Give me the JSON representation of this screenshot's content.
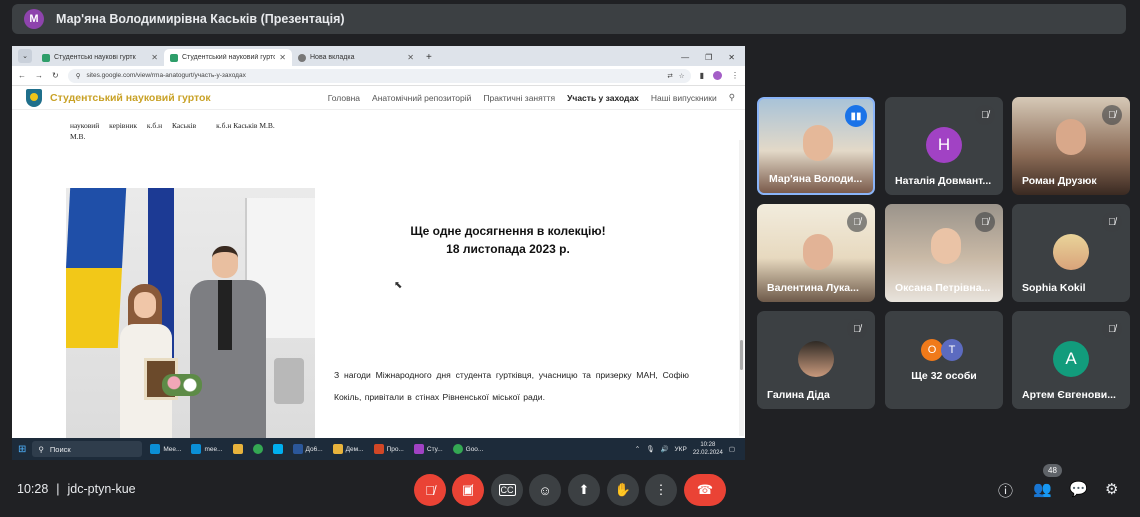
{
  "presenter": {
    "initial": "M",
    "title": "Мар'яна Володимирівна Каськів (Презентація)"
  },
  "browser": {
    "tabs": [
      {
        "label": "Студентські наукові гуртк",
        "active": false
      },
      {
        "label": "Студентський науковий гурто",
        "active": true
      },
      {
        "label": "Нова вкладка",
        "active": false
      }
    ],
    "url": "sites.google.com/view/rma-anatogurt/участь-у-заходах"
  },
  "site": {
    "name": "Студентський науковий гурток",
    "nav": [
      "Головна",
      "Анатомічний репозиторій",
      "Практичні заняття",
      "Участь у заходах",
      "Наші випускники"
    ],
    "active_nav": "Участь у заходах",
    "supervisor_line1": "науковий керівник к.б.н Каськів",
    "supervisor_line1b": "к.б.н Каськів М.В.",
    "supervisor_line2": "М.В.",
    "heading_line1": "Ще одне досягнення в колекцію!",
    "heading_line2": "18 листопада 2023 р.",
    "paragraph": "З нагоди Міжнародного дня студента гуртківця, учасницю та призерку МАН, Софію Кокіль, привітали в стінах Рівненської міської ради."
  },
  "taskbar": {
    "search": "Поиск",
    "apps": [
      "Mee...",
      "mee...",
      "До6...",
      "Дем...",
      "Про...",
      "Сту...",
      "Goo..."
    ],
    "lang": "УКР",
    "time": "10:28",
    "date": "22.02.2024"
  },
  "participants": [
    {
      "name": "Мар'яна Володи...",
      "kind": "video",
      "speaking": true
    },
    {
      "name": "Наталія Довмант...",
      "kind": "initial",
      "initial": "Н",
      "color": "#a142c4"
    },
    {
      "name": "Роман Друзюк",
      "kind": "video"
    },
    {
      "name": "Валентина Лука...",
      "kind": "video"
    },
    {
      "name": "Оксана Петрівна...",
      "kind": "video"
    },
    {
      "name": "Sophia Kokil",
      "kind": "photo"
    },
    {
      "name": "Галина Діда",
      "kind": "photo"
    },
    {
      "more_label": "Ще 32 особи",
      "initials": [
        "О",
        "Т"
      ],
      "colors": [
        "#f07a1a",
        "#5c6bc0"
      ]
    },
    {
      "name": "Артем Євгенови...",
      "kind": "initial",
      "initial": "А",
      "color": "#129c7c"
    }
  ],
  "meeting": {
    "time": "10:28",
    "code": "jdc-ptyn-kue",
    "participant_count": "48"
  },
  "colors": {
    "background": "#202124",
    "tile": "#3c4043",
    "danger": "#ea4335",
    "active_border": "#8ab4f8"
  }
}
